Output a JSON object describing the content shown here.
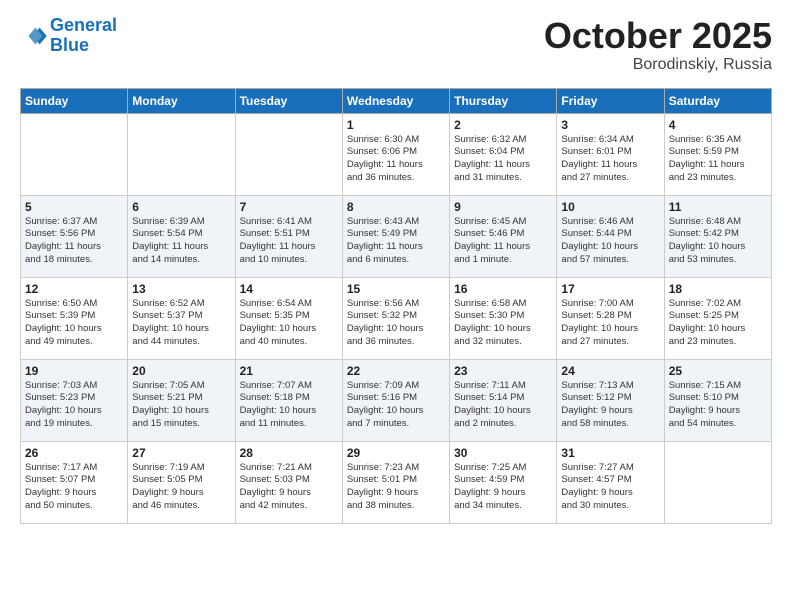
{
  "header": {
    "logo_line1": "General",
    "logo_line2": "Blue",
    "month": "October 2025",
    "location": "Borodinskiy, Russia"
  },
  "weekdays": [
    "Sunday",
    "Monday",
    "Tuesday",
    "Wednesday",
    "Thursday",
    "Friday",
    "Saturday"
  ],
  "weeks": [
    [
      {
        "day": "",
        "info": ""
      },
      {
        "day": "",
        "info": ""
      },
      {
        "day": "",
        "info": ""
      },
      {
        "day": "1",
        "info": "Sunrise: 6:30 AM\nSunset: 6:06 PM\nDaylight: 11 hours\nand 36 minutes."
      },
      {
        "day": "2",
        "info": "Sunrise: 6:32 AM\nSunset: 6:04 PM\nDaylight: 11 hours\nand 31 minutes."
      },
      {
        "day": "3",
        "info": "Sunrise: 6:34 AM\nSunset: 6:01 PM\nDaylight: 11 hours\nand 27 minutes."
      },
      {
        "day": "4",
        "info": "Sunrise: 6:35 AM\nSunset: 5:59 PM\nDaylight: 11 hours\nand 23 minutes."
      }
    ],
    [
      {
        "day": "5",
        "info": "Sunrise: 6:37 AM\nSunset: 5:56 PM\nDaylight: 11 hours\nand 18 minutes."
      },
      {
        "day": "6",
        "info": "Sunrise: 6:39 AM\nSunset: 5:54 PM\nDaylight: 11 hours\nand 14 minutes."
      },
      {
        "day": "7",
        "info": "Sunrise: 6:41 AM\nSunset: 5:51 PM\nDaylight: 11 hours\nand 10 minutes."
      },
      {
        "day": "8",
        "info": "Sunrise: 6:43 AM\nSunset: 5:49 PM\nDaylight: 11 hours\nand 6 minutes."
      },
      {
        "day": "9",
        "info": "Sunrise: 6:45 AM\nSunset: 5:46 PM\nDaylight: 11 hours\nand 1 minute."
      },
      {
        "day": "10",
        "info": "Sunrise: 6:46 AM\nSunset: 5:44 PM\nDaylight: 10 hours\nand 57 minutes."
      },
      {
        "day": "11",
        "info": "Sunrise: 6:48 AM\nSunset: 5:42 PM\nDaylight: 10 hours\nand 53 minutes."
      }
    ],
    [
      {
        "day": "12",
        "info": "Sunrise: 6:50 AM\nSunset: 5:39 PM\nDaylight: 10 hours\nand 49 minutes."
      },
      {
        "day": "13",
        "info": "Sunrise: 6:52 AM\nSunset: 5:37 PM\nDaylight: 10 hours\nand 44 minutes."
      },
      {
        "day": "14",
        "info": "Sunrise: 6:54 AM\nSunset: 5:35 PM\nDaylight: 10 hours\nand 40 minutes."
      },
      {
        "day": "15",
        "info": "Sunrise: 6:56 AM\nSunset: 5:32 PM\nDaylight: 10 hours\nand 36 minutes."
      },
      {
        "day": "16",
        "info": "Sunrise: 6:58 AM\nSunset: 5:30 PM\nDaylight: 10 hours\nand 32 minutes."
      },
      {
        "day": "17",
        "info": "Sunrise: 7:00 AM\nSunset: 5:28 PM\nDaylight: 10 hours\nand 27 minutes."
      },
      {
        "day": "18",
        "info": "Sunrise: 7:02 AM\nSunset: 5:25 PM\nDaylight: 10 hours\nand 23 minutes."
      }
    ],
    [
      {
        "day": "19",
        "info": "Sunrise: 7:03 AM\nSunset: 5:23 PM\nDaylight: 10 hours\nand 19 minutes."
      },
      {
        "day": "20",
        "info": "Sunrise: 7:05 AM\nSunset: 5:21 PM\nDaylight: 10 hours\nand 15 minutes."
      },
      {
        "day": "21",
        "info": "Sunrise: 7:07 AM\nSunset: 5:18 PM\nDaylight: 10 hours\nand 11 minutes."
      },
      {
        "day": "22",
        "info": "Sunrise: 7:09 AM\nSunset: 5:16 PM\nDaylight: 10 hours\nand 7 minutes."
      },
      {
        "day": "23",
        "info": "Sunrise: 7:11 AM\nSunset: 5:14 PM\nDaylight: 10 hours\nand 2 minutes."
      },
      {
        "day": "24",
        "info": "Sunrise: 7:13 AM\nSunset: 5:12 PM\nDaylight: 9 hours\nand 58 minutes."
      },
      {
        "day": "25",
        "info": "Sunrise: 7:15 AM\nSunset: 5:10 PM\nDaylight: 9 hours\nand 54 minutes."
      }
    ],
    [
      {
        "day": "26",
        "info": "Sunrise: 7:17 AM\nSunset: 5:07 PM\nDaylight: 9 hours\nand 50 minutes."
      },
      {
        "day": "27",
        "info": "Sunrise: 7:19 AM\nSunset: 5:05 PM\nDaylight: 9 hours\nand 46 minutes."
      },
      {
        "day": "28",
        "info": "Sunrise: 7:21 AM\nSunset: 5:03 PM\nDaylight: 9 hours\nand 42 minutes."
      },
      {
        "day": "29",
        "info": "Sunrise: 7:23 AM\nSunset: 5:01 PM\nDaylight: 9 hours\nand 38 minutes."
      },
      {
        "day": "30",
        "info": "Sunrise: 7:25 AM\nSunset: 4:59 PM\nDaylight: 9 hours\nand 34 minutes."
      },
      {
        "day": "31",
        "info": "Sunrise: 7:27 AM\nSunset: 4:57 PM\nDaylight: 9 hours\nand 30 minutes."
      },
      {
        "day": "",
        "info": ""
      }
    ]
  ]
}
